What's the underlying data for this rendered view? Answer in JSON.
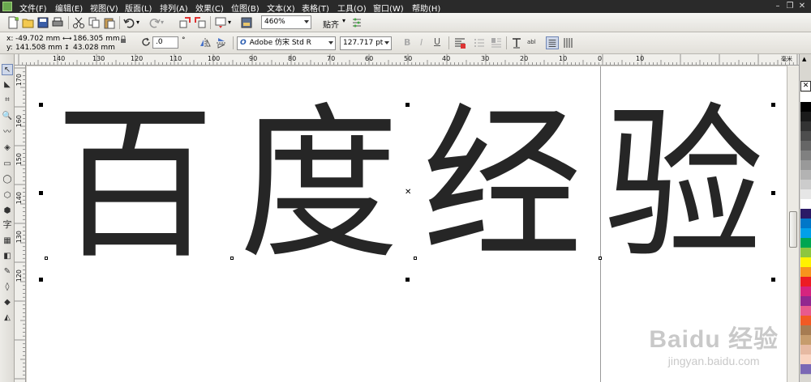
{
  "menu": {
    "items": [
      "文件(F)",
      "编辑(E)",
      "视图(V)",
      "版面(L)",
      "排列(A)",
      "效果(C)",
      "位图(B)",
      "文本(X)",
      "表格(T)",
      "工具(O)",
      "窗口(W)",
      "帮助(H)"
    ]
  },
  "toolbar": {
    "zoom_value": "460%",
    "snap_label": "贴齐"
  },
  "propbar": {
    "x_label": "x:",
    "x_value": "-49.702 mm",
    "y_label": "y:",
    "y_value": "141.508 mm",
    "width_value": "186.305 mm",
    "height_value": "43.028 mm",
    "rotation_value": ".0",
    "rotation_unit": "°",
    "font_icon": "O",
    "font_name": "Adobe 仿宋 Std R",
    "font_size": "127.717 pt"
  },
  "ruler_h": {
    "labels": [
      "140",
      "130",
      "120",
      "110",
      "100",
      "90",
      "80",
      "70",
      "60",
      "50",
      "40",
      "30",
      "20",
      "10",
      "0",
      "10"
    ],
    "unit": "毫米"
  },
  "ruler_v": {
    "labels": [
      "170",
      "160",
      "150",
      "140",
      "130",
      "120"
    ]
  },
  "canvas": {
    "characters": [
      "百",
      "度",
      "经",
      "验"
    ],
    "watermark_main": "Baidu 经验",
    "watermark_sub": "jingyan.baidu.com"
  },
  "palette": {
    "colors": [
      "#ffffff",
      "#000000",
      "#1a1a1a",
      "#333333",
      "#4d4d4d",
      "#666666",
      "#808080",
      "#999999",
      "#b3b3b3",
      "#cccccc",
      "#e6e6e6",
      "#ffffff",
      "#2b1a66",
      "#0077c8",
      "#00a0e9",
      "#00a651",
      "#8dc63f",
      "#fff200",
      "#f7941d",
      "#ed1c24",
      "#d6247f",
      "#92278f",
      "#e85a8c",
      "#f15a24",
      "#a67c52",
      "#c69c6d",
      "#e6b9a2",
      "#f9d3c0",
      "#7b68b5",
      "#9b9be0",
      "#b5b5e8",
      "#6f7ab5",
      "#5a78b8",
      "#4a6aa8",
      "#3f5b95"
    ]
  }
}
